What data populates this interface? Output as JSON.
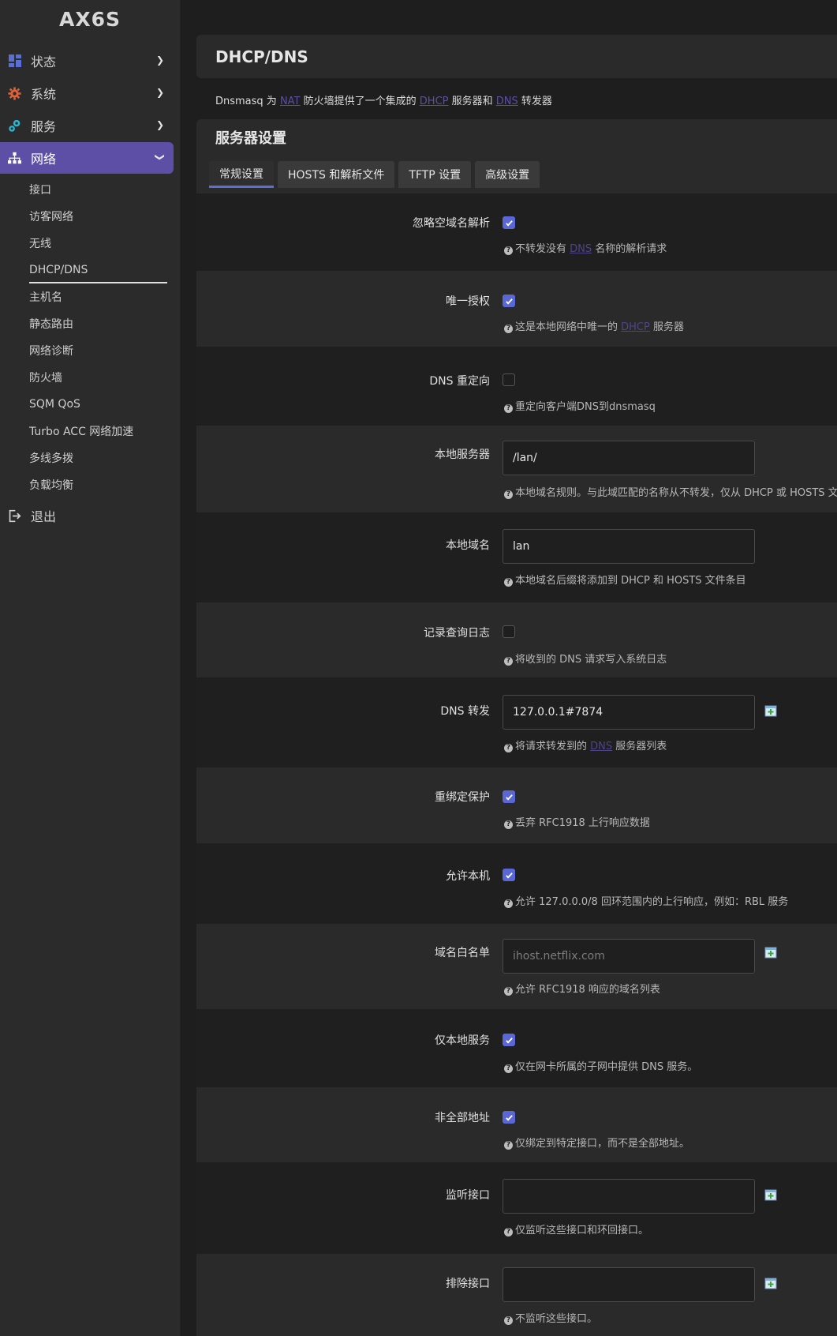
{
  "sidebar": {
    "brand": "AX6S",
    "items": [
      {
        "label": "状态",
        "icon": "dashboard-icon"
      },
      {
        "label": "系统",
        "icon": "gear-icon"
      },
      {
        "label": "服务",
        "icon": "services-icon"
      },
      {
        "label": "网络",
        "icon": "network-icon"
      }
    ],
    "network_sub": [
      "接口",
      "访客网络",
      "无线",
      "DHCP/DNS",
      "主机名",
      "静态路由",
      "网络诊断",
      "防火墙",
      "SQM QoS",
      "Turbo ACC 网络加速",
      "多线多拨",
      "负载均衡"
    ],
    "logout": "退出"
  },
  "page": {
    "title": "DHCP/DNS",
    "desc": {
      "p1": "Dnsmasq 为 ",
      "nat": "NAT",
      "p2": " 防火墙提供了一个集成的 ",
      "dhcp": "DHCP",
      "p3": " 服务器和 ",
      "dns": "DNS",
      "p4": " 转发器"
    },
    "section_title": "服务器设置",
    "tabs": [
      "常规设置",
      "HOSTS 和解析文件",
      "TFTP 设置",
      "高级设置"
    ]
  },
  "fields": {
    "f0": {
      "label": "忽略空域名解析",
      "checked": true,
      "h1": "不转发没有 ",
      "hlink": "DNS",
      "h2": " 名称的解析请求"
    },
    "f1": {
      "label": "唯一授权",
      "checked": true,
      "h1": "这是本地网络中唯一的 ",
      "hlink": "DHCP",
      "h2": " 服务器"
    },
    "f2": {
      "label": "DNS 重定向",
      "checked": false,
      "h1": "重定向客户端DNS到dnsmasq"
    },
    "f3": {
      "label": "本地服务器",
      "value": "/lan/",
      "h1": "本地域名规则。与此域匹配的名称从不转发，仅从 DHCP 或 HOSTS 文件"
    },
    "f4": {
      "label": "本地域名",
      "value": "lan",
      "h1": "本地域名后缀将添加到 DHCP 和 HOSTS 文件条目"
    },
    "f5": {
      "label": "记录查询日志",
      "checked": false,
      "h1": "将收到的 DNS 请求写入系统日志"
    },
    "f6": {
      "label": "DNS 转发",
      "value": "127.0.0.1#7874",
      "h1": "将请求转发到的 ",
      "hlink": "DNS",
      "h2": " 服务器列表"
    },
    "f7": {
      "label": "重绑定保护",
      "checked": true,
      "h1": "丢弃 RFC1918 上行响应数据"
    },
    "f8": {
      "label": "允许本机",
      "checked": true,
      "h1": "允许 127.0.0.0/8 回环范围内的上行响应，例如：RBL 服务"
    },
    "f9": {
      "label": "域名白名单",
      "placeholder": "ihost.netflix.com",
      "h1": "允许 RFC1918 响应的域名列表"
    },
    "f10": {
      "label": "仅本地服务",
      "checked": true,
      "h1": "仅在网卡所属的子网中提供 DNS 服务。"
    },
    "f11": {
      "label": "非全部地址",
      "checked": true,
      "h1": "仅绑定到特定接口，而不是全部地址。"
    },
    "f12": {
      "label": "监听接口",
      "value": "",
      "h1": "仅监听这些接口和环回接口。"
    },
    "f13": {
      "label": "排除接口",
      "value": "",
      "h1": "不监听这些接口。"
    }
  }
}
